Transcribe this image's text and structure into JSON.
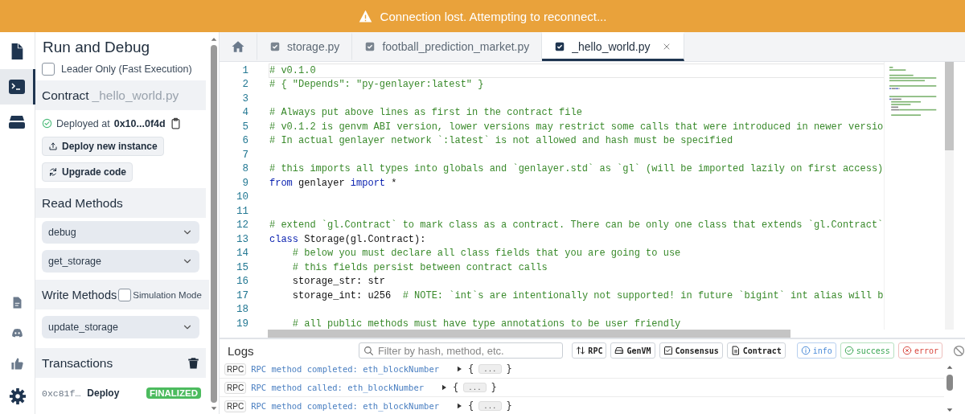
{
  "banner": {
    "message": "Connection lost. Attempting to reconnect..."
  },
  "activity_bar": {
    "items": [
      {
        "selected": false
      },
      {
        "selected": true
      },
      {
        "selected": false
      }
    ]
  },
  "run_panel": {
    "title": "Run and Debug",
    "leader_only": {
      "label": "Leader Only (Fast Execution)",
      "checked": false
    },
    "contract": {
      "label": "Contract",
      "file": "_hello_world.py"
    },
    "deployed": {
      "label": "Deployed at",
      "address": "0x10...0f4d"
    },
    "actions": [
      {
        "label": "Deploy new instance"
      },
      {
        "label": "Upgrade code"
      }
    ],
    "read_methods": {
      "title": "Read Methods",
      "methods": [
        "debug",
        "get_storage"
      ]
    },
    "write_methods": {
      "title": "Write Methods",
      "simulation": {
        "label": "Simulation Mode",
        "checked": false
      },
      "methods": [
        "update_storage"
      ]
    },
    "transactions": {
      "title": "Transactions",
      "items": [
        {
          "hash": "0xc81f…",
          "type": "Deploy",
          "status": "FINALIZED"
        }
      ]
    }
  },
  "tabs": [
    {
      "kind": "home",
      "selected": false
    },
    {
      "kind": "file",
      "label": "storage.py",
      "selected": false,
      "closable": false
    },
    {
      "kind": "file",
      "label": "football_prediction_market.py",
      "selected": false,
      "closable": false
    },
    {
      "kind": "file",
      "label": "_hello_world.py",
      "selected": true,
      "closable": true
    }
  ],
  "editor": {
    "lines": [
      {
        "number": "1",
        "current": true,
        "tokens": [
          {
            "kind": "comment",
            "text": "# v0.1.0"
          }
        ]
      },
      {
        "number": "2",
        "current": false,
        "tokens": [
          {
            "kind": "comment",
            "text": "# { \"Depends\": \"py-genlayer:latest\" }"
          }
        ]
      },
      {
        "number": "3",
        "current": false
      },
      {
        "number": "4",
        "current": false,
        "tokens": [
          {
            "kind": "comment",
            "text": "# Always put above lines as first in the contract file"
          }
        ]
      },
      {
        "number": "5",
        "current": false,
        "tokens": [
          {
            "kind": "comment",
            "text": "# v0.1.2 is genvm ABI version, lower versions may restrict some calls that were introduced in newer versio"
          }
        ]
      },
      {
        "number": "6",
        "current": false,
        "tokens": [
          {
            "kind": "comment",
            "text": "# In actual genlayer network `:latest` is not allowed and hash must be specified"
          }
        ]
      },
      {
        "number": "7",
        "current": false
      },
      {
        "number": "8",
        "current": false,
        "tokens": [
          {
            "kind": "comment",
            "text": "# this imports all types into globals and `genlayer.std` as `gl` (will be imported lazily on first access)"
          }
        ]
      },
      {
        "number": "9",
        "current": false,
        "tokens": [
          {
            "kind": "keyword",
            "text": "from"
          },
          {
            "kind": "plain",
            "text": " genlayer "
          },
          {
            "kind": "keyword",
            "text": "import"
          },
          {
            "kind": "plain",
            "text": " *"
          }
        ]
      },
      {
        "number": "10",
        "current": false
      },
      {
        "number": "11",
        "current": false
      },
      {
        "number": "12",
        "current": false,
        "tokens": [
          {
            "kind": "comment",
            "text": "# extend `gl.Contract` to mark class as a contract. There can be only one class that extends `gl.Contract`"
          }
        ]
      },
      {
        "number": "13",
        "current": false,
        "tokens": [
          {
            "kind": "keyword",
            "text": "class"
          },
          {
            "kind": "plain",
            "text": " Storage(gl.Contract):"
          }
        ]
      },
      {
        "number": "14",
        "current": false,
        "tokens": [
          {
            "kind": "comment",
            "text": "    # below you must declare all class fields that you are going to use"
          }
        ]
      },
      {
        "number": "15",
        "current": false,
        "tokens": [
          {
            "kind": "comment",
            "text": "    # this fields persist between contract calls"
          }
        ]
      },
      {
        "number": "16",
        "current": false,
        "tokens": [
          {
            "kind": "plain",
            "text": "    storage_str: str"
          }
        ]
      },
      {
        "number": "17",
        "current": false,
        "tokens": [
          {
            "kind": "plain",
            "text": "    storage_int: u256  "
          },
          {
            "kind": "comment",
            "text": "# NOTE: `int`s are intentionally not supported! in future `bigint` int alias will b"
          }
        ]
      },
      {
        "number": "18",
        "current": false
      },
      {
        "number": "19",
        "current": false,
        "tokens": [
          {
            "kind": "comment",
            "text": "    # all public methods must have type annotations to be user friendly"
          }
        ]
      }
    ]
  },
  "logs": {
    "title": "Logs",
    "filter": {
      "placeholder": "Filter by hash, method, etc."
    },
    "filters": [
      {
        "kind": "neutral",
        "label": "RPC"
      },
      {
        "kind": "neutral",
        "label": "GenVM"
      },
      {
        "kind": "neutral",
        "label": "Consensus"
      },
      {
        "kind": "neutral",
        "label": "Contract"
      },
      {
        "kind": "info",
        "label": "info"
      },
      {
        "kind": "success",
        "label": "success"
      },
      {
        "kind": "error",
        "label": "error"
      }
    ],
    "entries": [
      {
        "source": "RPC",
        "message": "RPC method completed: eth_blockNumber",
        "open": "{",
        "summary": "...",
        "close": "}"
      },
      {
        "source": "RPC",
        "message": "RPC method called: eth_blockNumber",
        "open": "{",
        "summary": "...",
        "close": "}"
      },
      {
        "source": "RPC",
        "message": "RPC method completed: eth_blockNumber",
        "open": "{",
        "summary": "...",
        "close": "}"
      }
    ]
  }
}
